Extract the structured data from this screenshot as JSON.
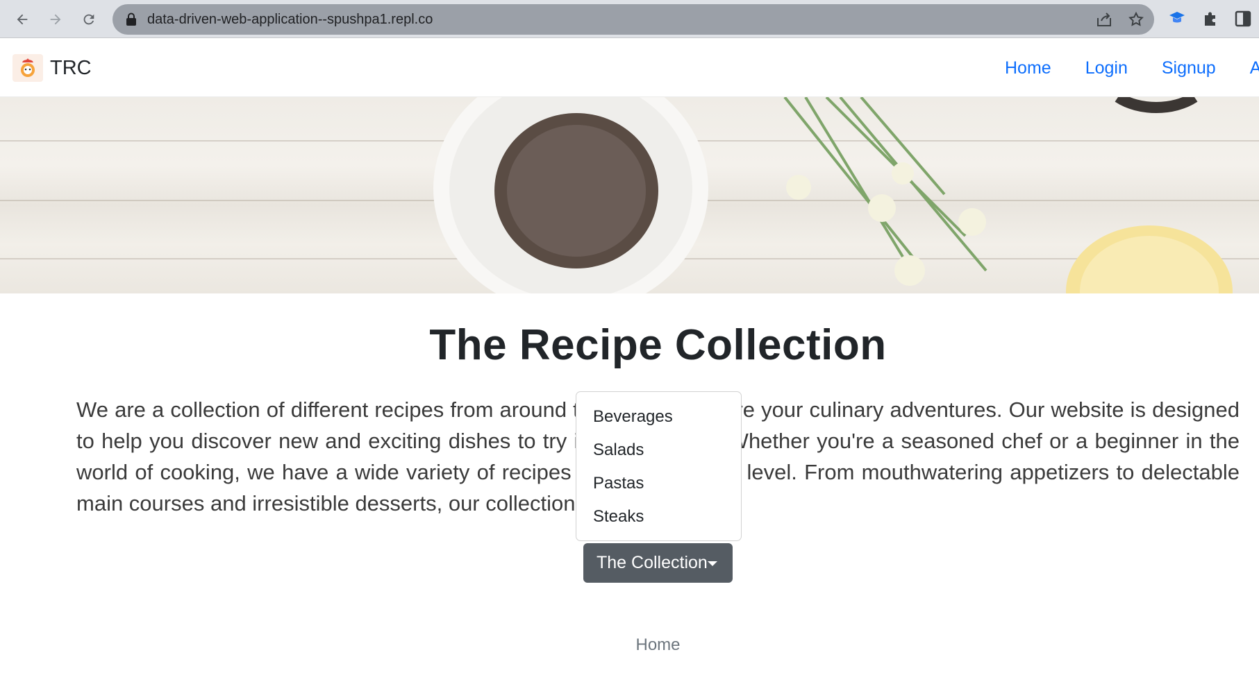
{
  "browser": {
    "url": "data-driven-web-application--spushpa1.repl.co"
  },
  "navbar": {
    "brand": "TRC",
    "links": [
      "Home",
      "Login",
      "Signup",
      "Ab"
    ]
  },
  "main": {
    "title": "The Recipe Collection",
    "paragraph": "We are a collection of different recipes from around the world to inspire your culinary adventures. Our website is designed to help you discover new and exciting dishes to try in your kitchen. Whether you're a seasoned chef or a beginner in the world of cooking, we have a wide variety of recipes to suit every skill level. From mouthwatering appetizers to delectable main courses and irresistible desserts, our collection has it all."
  },
  "dropdown": {
    "button_label": "The Collection",
    "items": [
      "Beverages",
      "Salads",
      "Pastas",
      "Steaks"
    ]
  },
  "footer": {
    "link": "Home"
  },
  "colors": {
    "link": "#0d6efd",
    "button": "#555c63",
    "chrome": "#dee1e6"
  }
}
